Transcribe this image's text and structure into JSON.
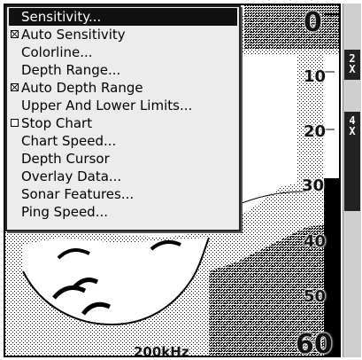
{
  "menu": {
    "items": [
      {
        "label": "Sensitivity...",
        "checkbox": false,
        "selected": true
      },
      {
        "label": "Auto Sensitivity",
        "checkbox": true,
        "checked": true
      },
      {
        "label": "Colorline...",
        "checkbox": false
      },
      {
        "label": "Depth Range...",
        "checkbox": false
      },
      {
        "label": "Auto Depth Range",
        "checkbox": true,
        "checked": true
      },
      {
        "label": "Upper And Lower Limits...",
        "checkbox": false
      },
      {
        "label": "Stop Chart",
        "checkbox": true,
        "checked": false
      },
      {
        "label": "Chart Speed...",
        "checkbox": false
      },
      {
        "label": "Depth Cursor",
        "checkbox": false
      },
      {
        "label": "Overlay Data...",
        "checkbox": false
      },
      {
        "label": "Sonar Features...",
        "checkbox": false
      },
      {
        "label": "Ping Speed...",
        "checkbox": false
      }
    ]
  },
  "depth_scale": {
    "top": "0",
    "marks": [
      "10",
      "20",
      "30",
      "40",
      "50"
    ],
    "bottom": "60"
  },
  "frequency": "200kHz",
  "zoom": {
    "buttons": [
      {
        "top_line": "2",
        "bottom_line": "X"
      },
      {
        "top_line": "4",
        "bottom_line": "X"
      }
    ]
  },
  "colors": {
    "menu_bg": "#ececec",
    "selection": "#111111",
    "echo": "#000000"
  }
}
